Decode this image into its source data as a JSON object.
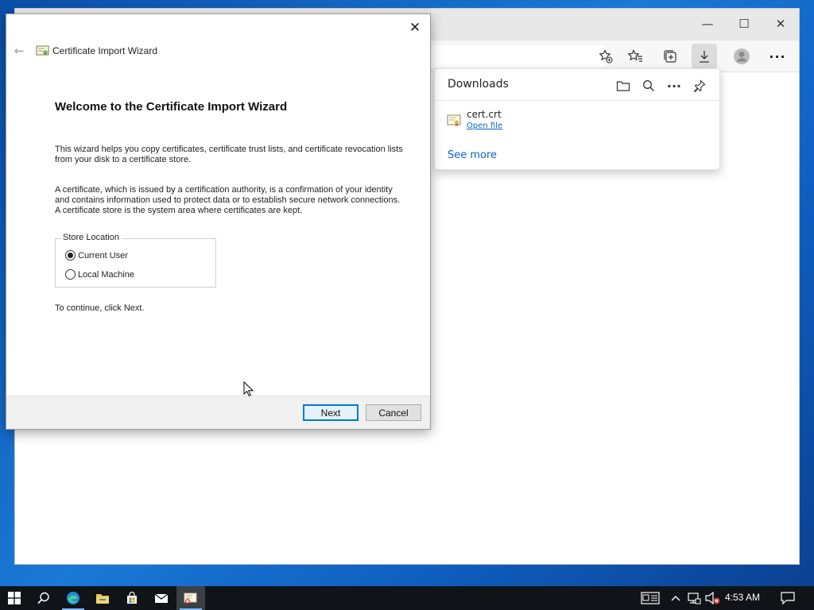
{
  "browser": {
    "window_controls": {
      "minimize": "—",
      "maximize": "☐",
      "close": "✕"
    },
    "toolbar": {
      "add_favorite_icon": "star-plus-icon",
      "favorites_icon": "favorites-icon",
      "collections_icon": "collections-icon",
      "downloads_icon": "download-icon",
      "profile_icon": "profile-icon",
      "menu_icon": "more-icon",
      "menu_label": "···"
    },
    "downloads_panel": {
      "title": "Downloads",
      "more_label": "···",
      "items": [
        {
          "file_name": "cert.crt",
          "action": "Open file"
        }
      ],
      "see_more": "See more"
    }
  },
  "wizard": {
    "back_label": "←",
    "close_label": "✕",
    "title": "Certificate Import Wizard",
    "heading": "Welcome to the Certificate Import Wizard",
    "paragraph_1": "This wizard helps you copy certificates, certificate trust lists, and certificate revocation lists from your disk to a certificate store.",
    "paragraph_2": "A certificate, which is issued by a certification authority, is a confirmation of your identity and contains information used to protect data or to establish secure network connections. A certificate store is the system area where certificates are kept.",
    "store_location": {
      "legend": "Store Location",
      "options": [
        {
          "label": "Current User",
          "selected": true
        },
        {
          "label": "Local Machine",
          "selected": false
        }
      ]
    },
    "continue_text": "To continue, click Next.",
    "buttons": {
      "next": "Next",
      "cancel": "Cancel"
    }
  },
  "taskbar": {
    "clock": "4:53 AM",
    "colors": {
      "accent": "#0078d7",
      "background": "#101318"
    }
  }
}
